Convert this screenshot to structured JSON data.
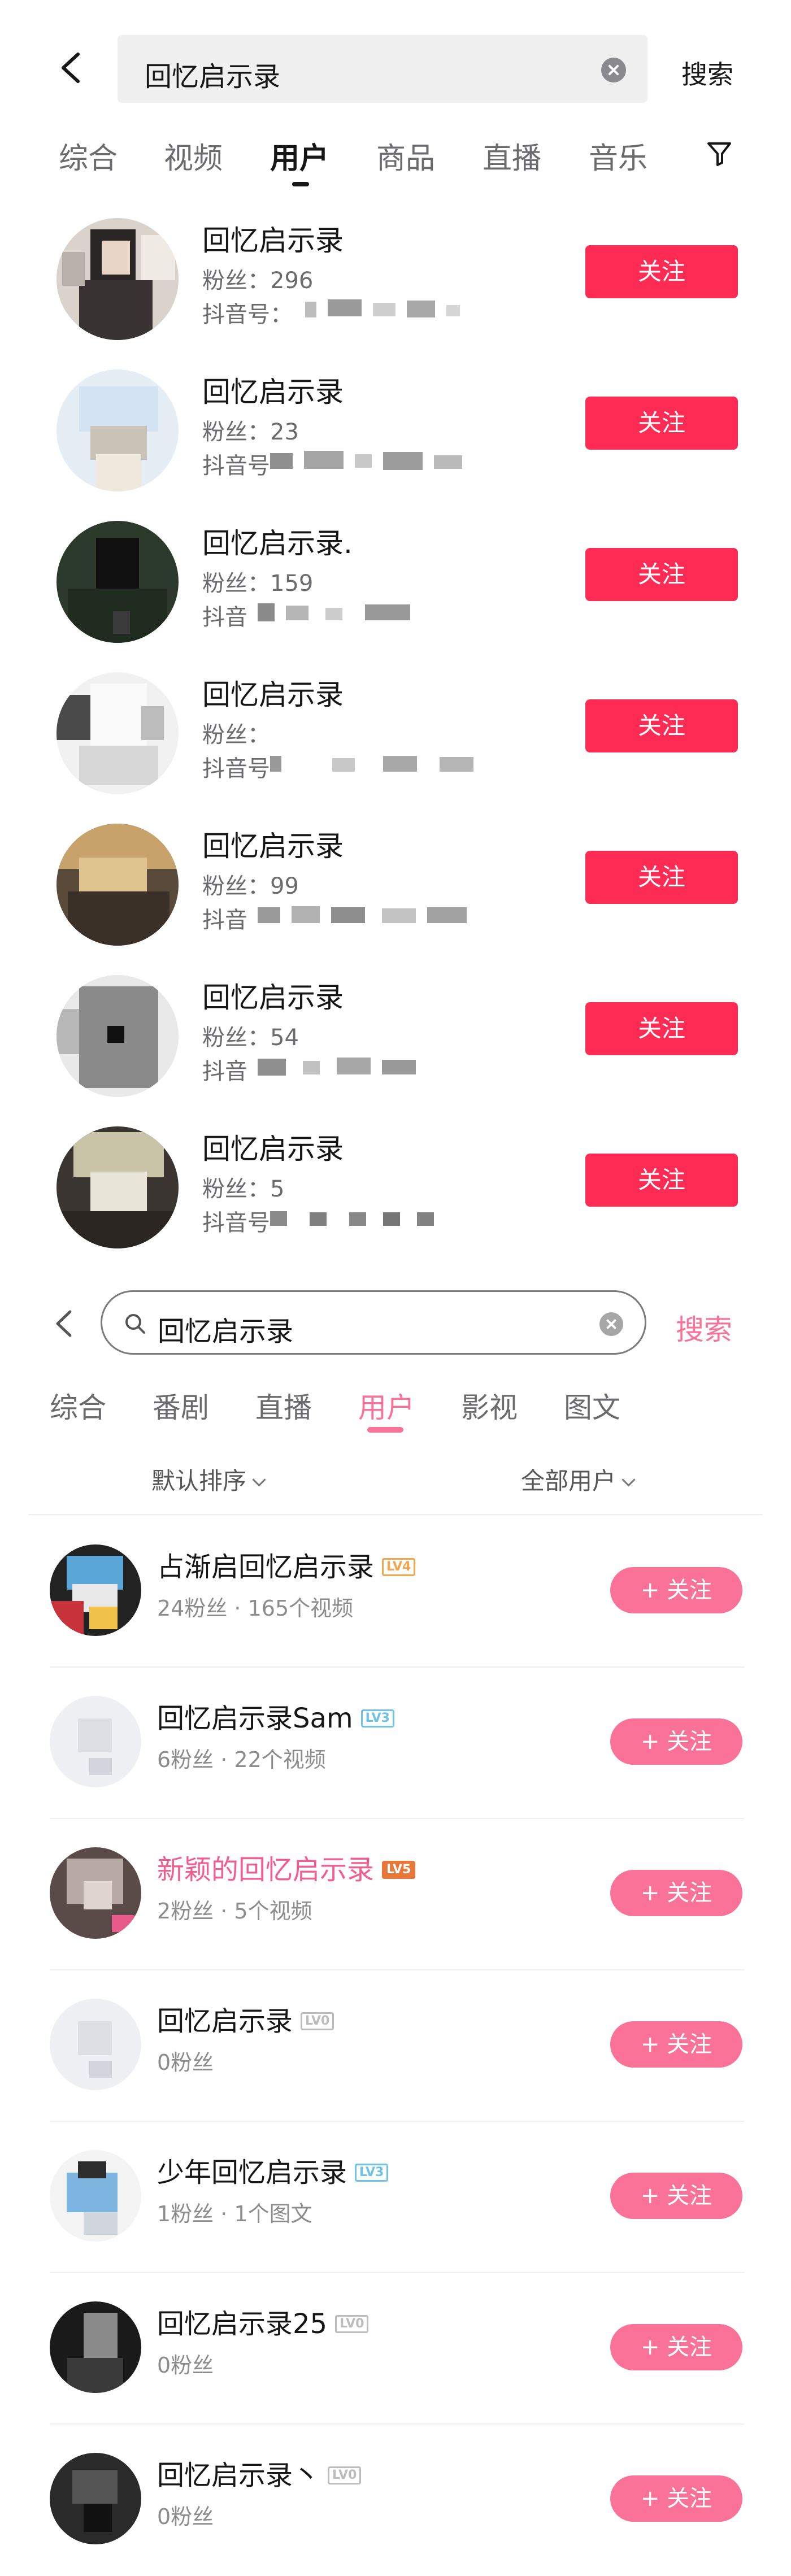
{
  "section1": {
    "search": {
      "query": "回忆启示录",
      "button": "搜索"
    },
    "tabs": [
      "综合",
      "视频",
      "用户",
      "商品",
      "直播",
      "音乐"
    ],
    "active_tab": "用户",
    "accent_color": "#fe2c55",
    "users": [
      {
        "name": "回忆启示录",
        "fans": "粉丝：296",
        "id_label": "抖音号：",
        "follow": "关注"
      },
      {
        "name": "回忆启示录",
        "fans": "粉丝：23",
        "id_label": "抖音号",
        "follow": "关注"
      },
      {
        "name": "回忆启示录.",
        "fans": "粉丝：159",
        "id_label": "抖音",
        "follow": "关注"
      },
      {
        "name": "回忆启示录",
        "fans": "粉丝：",
        "id_label": "抖音号",
        "follow": "关注"
      },
      {
        "name": "回忆启示录",
        "fans": "粉丝：99",
        "id_label": "抖音",
        "follow": "关注"
      },
      {
        "name": "回忆启示录",
        "fans": "粉丝：54",
        "id_label": "抖音",
        "follow": "关注"
      },
      {
        "name": "回忆启示录",
        "fans": "粉丝：5",
        "id_label": "抖音号",
        "follow": "关注"
      }
    ]
  },
  "section2": {
    "search": {
      "query": "回忆启示录",
      "button": "搜索"
    },
    "tabs": [
      "综合",
      "番剧",
      "直播",
      "用户",
      "影视",
      "图文"
    ],
    "active_tab": "用户",
    "sort_default": "默认排序",
    "sort_scope": "全部用户",
    "accent_color": "#fb7299",
    "users": [
      {
        "name": "占渐启回忆启示录",
        "level": "LV4",
        "level_color": "#f7a54a",
        "meta": "24粉丝 · 165个视频",
        "follow": "+ 关注"
      },
      {
        "name": "回忆启示录Sam",
        "level": "LV3",
        "level_color": "#6ec1e8",
        "meta": "6粉丝 · 22个视频",
        "follow": "+ 关注"
      },
      {
        "name": "新颖的回忆启示录",
        "level": "LV5",
        "level_color": "#e8773a",
        "meta": "2粉丝 · 5个视频",
        "follow": "+ 关注",
        "highlight": true
      },
      {
        "name": "回忆启示录",
        "level": "LV0",
        "level_color": "#bcbcbc",
        "meta": "0粉丝",
        "follow": "+ 关注"
      },
      {
        "name": "少年回忆启示录",
        "level": "LV3",
        "level_color": "#6ec1e8",
        "meta": "1粉丝 · 1个图文",
        "follow": "+ 关注"
      },
      {
        "name": "回忆启示录25",
        "level": "LV0",
        "level_color": "#bcbcbc",
        "meta": "0粉丝",
        "follow": "+ 关注"
      },
      {
        "name": "回忆启示录丶",
        "level": "LV0",
        "level_color": "#bcbcbc",
        "meta": "0粉丝",
        "follow": "+ 关注"
      }
    ]
  }
}
